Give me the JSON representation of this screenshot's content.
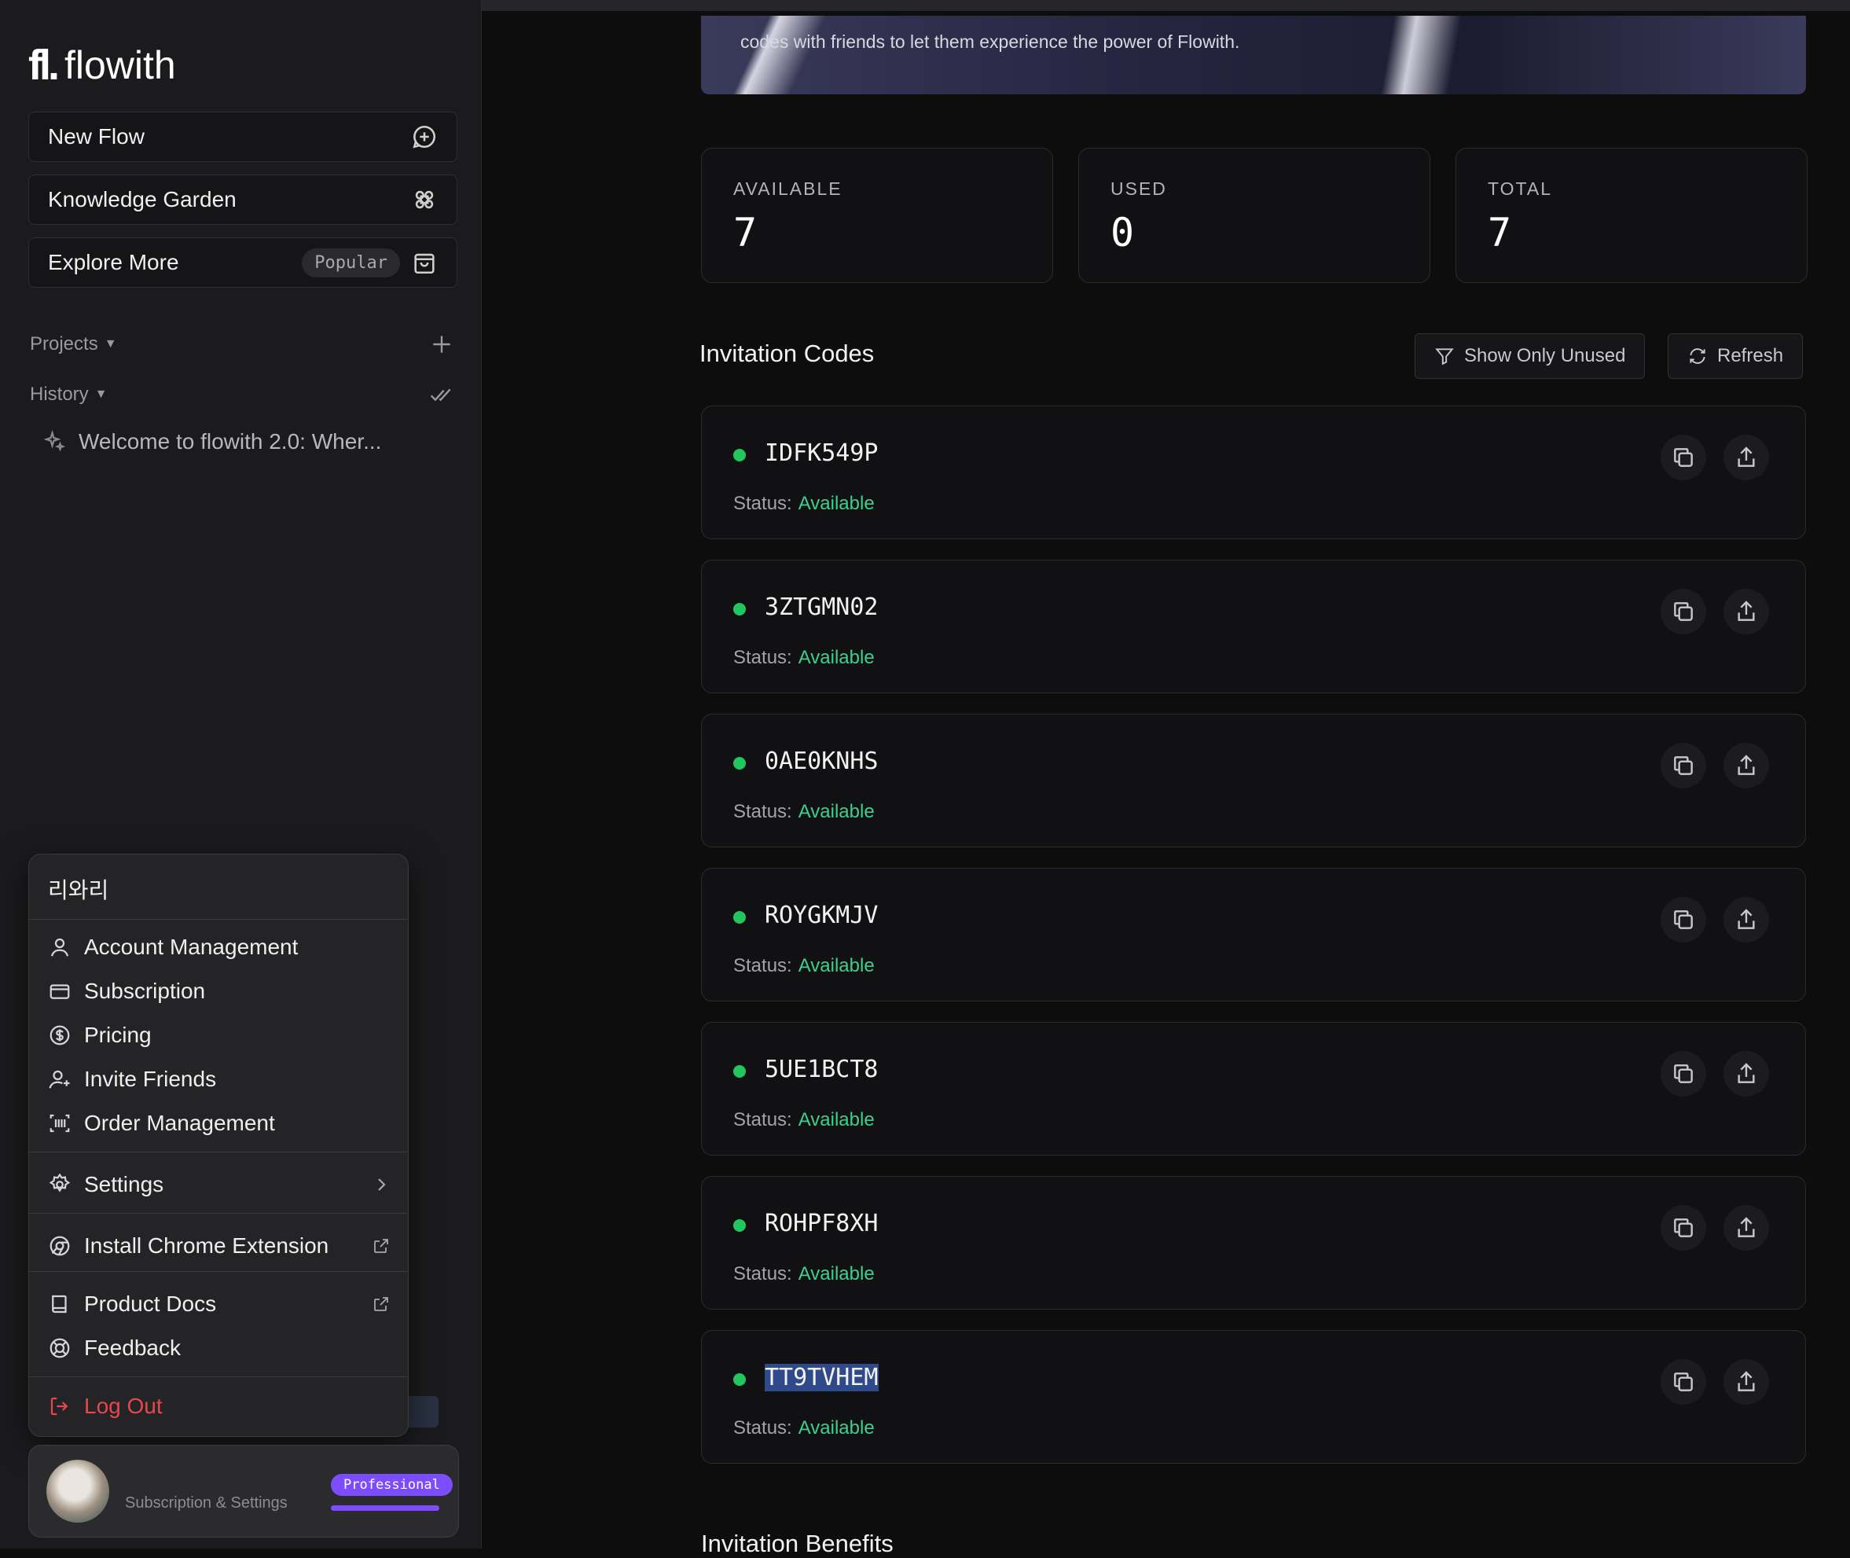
{
  "app": {
    "name": "flowith",
    "logo_mark": "fl."
  },
  "sidebar": {
    "new_flow": "New Flow",
    "knowledge_garden": "Knowledge Garden",
    "explore_more": "Explore More",
    "popular_badge": "Popular",
    "projects": "Projects",
    "history": "History",
    "history_items": [
      "Welcome to flowith 2.0: Wher..."
    ]
  },
  "menu": {
    "username": "리와리",
    "items": {
      "account": "Account Management",
      "subscription": "Subscription",
      "pricing": "Pricing",
      "invite": "Invite Friends",
      "orders": "Order Management",
      "settings": "Settings",
      "chrome": "Install Chrome Extension",
      "docs": "Product Docs",
      "feedback": "Feedback",
      "logout": "Log Out"
    }
  },
  "profile": {
    "subtitle": "Subscription & Settings",
    "plan": "Professional"
  },
  "banner": {
    "text": "codes with friends to let them experience the power of Flowith."
  },
  "stats": {
    "available": {
      "label": "AVAILABLE",
      "value": "7"
    },
    "used": {
      "label": "USED",
      "value": "0"
    },
    "total": {
      "label": "TOTAL",
      "value": "7"
    }
  },
  "codes_section": {
    "title": "Invitation Codes",
    "show_unused": "Show Only Unused",
    "refresh": "Refresh",
    "status_label": "Status:",
    "codes": [
      {
        "code": "IDFK549P",
        "status": "Available"
      },
      {
        "code": "3ZTGMN02",
        "status": "Available"
      },
      {
        "code": "0AE0KNHS",
        "status": "Available"
      },
      {
        "code": "ROYGKMJV",
        "status": "Available"
      },
      {
        "code": "5UE1BCT8",
        "status": "Available"
      },
      {
        "code": "ROHPF8XH",
        "status": "Available"
      },
      {
        "code": "TT9TVHEM",
        "status": "Available"
      }
    ]
  },
  "benefits_title": "Invitation Benefits",
  "colors": {
    "accent": "#7c4dff",
    "available": "#3ecf8e",
    "status_dot": "#22c55e",
    "danger": "#e5484d"
  }
}
